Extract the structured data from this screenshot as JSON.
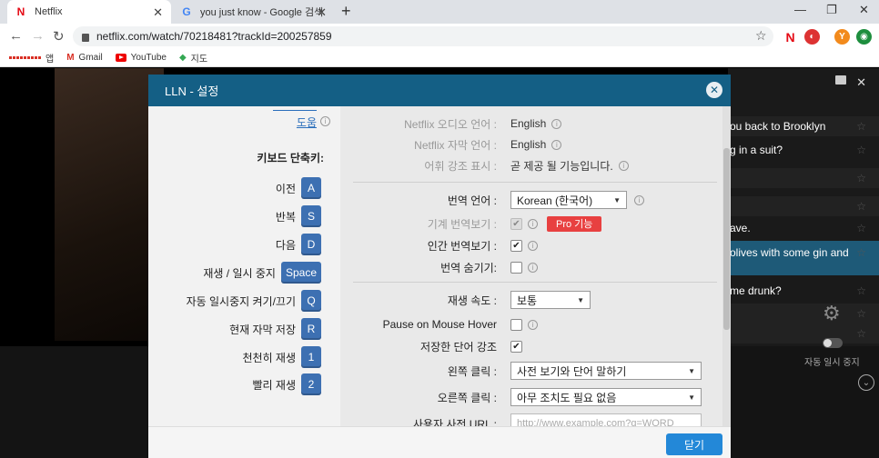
{
  "browser": {
    "tabs": [
      {
        "title": "Netflix",
        "favicon": "N",
        "active": true
      },
      {
        "title": "you just know - Google 검색",
        "favicon": "G",
        "active": false
      }
    ],
    "url": "netflix.com/watch/70218481?trackId=200257859",
    "profile_initial": "Y",
    "bookmarks": [
      "앱",
      "Gmail",
      "YouTube",
      "지도"
    ]
  },
  "subtitles": {
    "lines": [
      "ou back to Brooklyn",
      "g in a suit?",
      "",
      "ave.",
      "olives with some gin and",
      "me drunk?",
      ""
    ],
    "autopause_label": "자동 일시 중지"
  },
  "modal": {
    "title": "LLN - 설정",
    "close_label": "닫기",
    "left": {
      "help_link": "도움",
      "kb_title": "키보드 단축키:",
      "shortcuts": [
        {
          "label": "이전",
          "key": "A"
        },
        {
          "label": "반복",
          "key": "S"
        },
        {
          "label": "다음",
          "key": "D"
        },
        {
          "label": "재생 / 일시 중지",
          "key": "Space"
        },
        {
          "label": "자동 일시중지 켜기/끄기",
          "key": "Q"
        },
        {
          "label": "현재 자막 저장",
          "key": "R"
        },
        {
          "label": "천천히 재생",
          "key": "1"
        },
        {
          "label": "빨리 재생",
          "key": "2"
        }
      ]
    },
    "right": {
      "audio_lang_label": "Netflix 오디오 언어 :",
      "audio_lang_value": "English",
      "sub_lang_label": "Netflix 자막 언어 :",
      "sub_lang_value": "English",
      "vocab_label": "어휘 강조 표시 :",
      "vocab_value": "곧 제공 될 기능입니다.",
      "trans_lang_label": "번역 언어 :",
      "trans_lang_value": "Korean (한국어)",
      "machine_label": "기계 번역보기 :",
      "pro_label": "Pro 기능",
      "human_label": "인간 번역보기 :",
      "hide_label": "번역 숨기기:",
      "speed_label": "재생 속도 :",
      "speed_value": "보통",
      "hover_label": "Pause on Mouse Hover",
      "highlight_label": "저장한 단어 강조",
      "left_click_label": "왼쪽 클릭 :",
      "left_click_value": "사전 보기와 단어 말하기",
      "right_click_label": "오른쪽 클릭 :",
      "right_click_value": "아무 조치도 필요 없음",
      "dict_url_label": "사용자 사전 URL :",
      "dict_url_placeholder": "http://www.example.com?q=WORD"
    }
  }
}
